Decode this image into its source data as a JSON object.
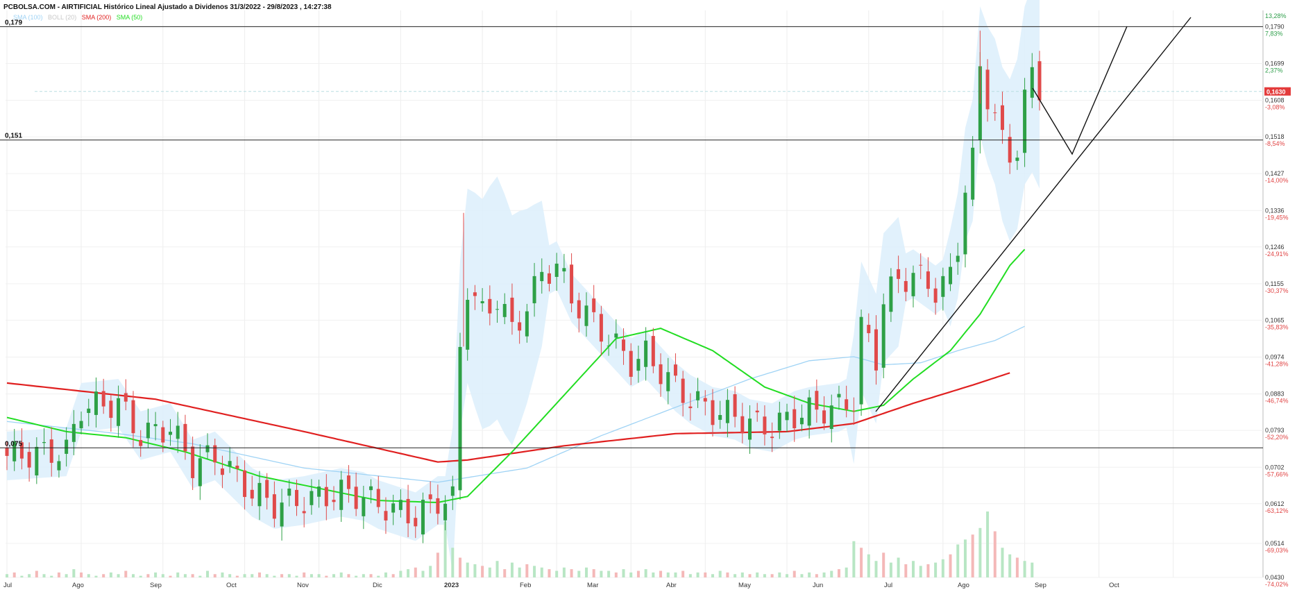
{
  "header": {
    "title": "PCBOLSA.COM - AIRTIFICIAL Histórico Lineal Ajustado a Dividenos 31/3/2022 - 29/8/2023 , 14:27:38"
  },
  "legend": [
    {
      "label": "SMA (100)",
      "color": "#9fd3f5"
    },
    {
      "label": "BOLL (20)",
      "color": "#c8c8c8"
    },
    {
      "label": "SMA (200)",
      "color": "#e02020"
    },
    {
      "label": "SMA (50)",
      "color": "#22dd22"
    }
  ],
  "colors": {
    "up": "#2ea046",
    "down": "#e04a4a",
    "band": "#dceefb",
    "sma100": "#9fd3f5",
    "sma200": "#e02020",
    "sma50": "#22dd22"
  },
  "chart_data": {
    "type": "candlestick",
    "ylim": [
      0.043,
      0.183
    ],
    "last_price": "0,1630",
    "x_labels": [
      "Jul",
      "Ago",
      "Sep",
      "Oct",
      "Nov",
      "Dic",
      "2023",
      "Feb",
      "Mar",
      "Abr",
      "May",
      "Jun",
      "Jul",
      "Ago",
      "Sep",
      "Oct"
    ],
    "y_ticks": [
      {
        "price": "0,1790",
        "pct": "7,83%"
      },
      {
        "price": "0,1699",
        "pct": "2,37%"
      },
      {
        "price": "0,1608",
        "pct": "-3,08%"
      },
      {
        "price": "0,1518",
        "pct": "-8,54%"
      },
      {
        "price": "0,1427",
        "pct": "-14,00%"
      },
      {
        "price": "0,1336",
        "pct": "-19,45%"
      },
      {
        "price": "0,1246",
        "pct": "-24,91%"
      },
      {
        "price": "0,1155",
        "pct": "-30,37%"
      },
      {
        "price": "0,1065",
        "pct": "-35,83%"
      },
      {
        "price": "0,0974",
        "pct": "-41,28%"
      },
      {
        "price": "0,0883",
        "pct": "-46,74%"
      },
      {
        "price": "0,0793",
        "pct": "-52,20%"
      },
      {
        "price": "0,0702",
        "pct": "-57,66%"
      },
      {
        "price": "0,0612",
        "pct": "-63,12%"
      },
      {
        "price": "0,0514",
        "pct": "-69,03%"
      },
      {
        "price": "0,0430",
        "pct": "-74,02%"
      }
    ],
    "top_pct": "13,28%",
    "horizontal_levels": [
      {
        "label": "0,179",
        "value": 0.179
      },
      {
        "label": "0,151",
        "value": 0.151
      },
      {
        "label": "0,075",
        "value": 0.075
      }
    ],
    "price_path": [
      [
        0,
        0.073
      ],
      [
        8,
        0.074
      ],
      [
        10,
        0.085
      ],
      [
        15,
        0.086
      ],
      [
        18,
        0.078
      ],
      [
        22,
        0.08
      ],
      [
        25,
        0.071
      ],
      [
        28,
        0.073
      ],
      [
        33,
        0.064
      ],
      [
        36,
        0.061
      ],
      [
        40,
        0.062
      ],
      [
        45,
        0.064
      ],
      [
        48,
        0.063
      ],
      [
        50,
        0.061
      ],
      [
        55,
        0.058
      ],
      [
        58,
        0.062
      ],
      [
        60,
        0.062
      ],
      [
        61,
        0.1
      ],
      [
        62,
        0.115
      ],
      [
        64,
        0.108
      ],
      [
        66,
        0.112
      ],
      [
        68,
        0.104
      ],
      [
        70,
        0.11
      ],
      [
        72,
        0.118
      ],
      [
        74,
        0.12
      ],
      [
        76,
        0.112
      ],
      [
        78,
        0.108
      ],
      [
        80,
        0.104
      ],
      [
        82,
        0.1
      ],
      [
        84,
        0.096
      ],
      [
        86,
        0.098
      ],
      [
        88,
        0.094
      ],
      [
        90,
        0.09
      ],
      [
        92,
        0.087
      ],
      [
        95,
        0.084
      ],
      [
        98,
        0.083
      ],
      [
        100,
        0.081
      ],
      [
        103,
        0.08
      ],
      [
        106,
        0.083
      ],
      [
        108,
        0.084
      ],
      [
        112,
        0.085
      ],
      [
        114,
        0.087
      ],
      [
        115,
        0.105
      ],
      [
        117,
        0.097
      ],
      [
        118,
        0.112
      ],
      [
        120,
        0.116
      ],
      [
        122,
        0.118
      ],
      [
        125,
        0.114
      ],
      [
        127,
        0.117
      ],
      [
        128,
        0.125
      ],
      [
        129,
        0.14
      ],
      [
        130,
        0.146
      ],
      [
        131,
        0.168
      ],
      [
        132,
        0.162
      ],
      [
        133,
        0.158
      ],
      [
        134,
        0.15
      ],
      [
        135,
        0.146
      ],
      [
        136,
        0.15
      ],
      [
        137,
        0.162
      ],
      [
        138,
        0.166
      ],
      [
        139,
        0.163
      ]
    ],
    "sma200": [
      [
        0,
        0.091
      ],
      [
        20,
        0.087
      ],
      [
        40,
        0.079
      ],
      [
        58,
        0.0715
      ],
      [
        62,
        0.072
      ],
      [
        75,
        0.0755
      ],
      [
        90,
        0.0785
      ],
      [
        105,
        0.079
      ],
      [
        114,
        0.081
      ],
      [
        122,
        0.086
      ],
      [
        130,
        0.0905
      ],
      [
        135,
        0.0935
      ]
    ],
    "sma50": [
      [
        0,
        0.0825
      ],
      [
        8,
        0.079
      ],
      [
        16,
        0.0775
      ],
      [
        24,
        0.074
      ],
      [
        34,
        0.068
      ],
      [
        42,
        0.065
      ],
      [
        50,
        0.062
      ],
      [
        58,
        0.0615
      ],
      [
        62,
        0.063
      ],
      [
        68,
        0.074
      ],
      [
        75,
        0.088
      ],
      [
        82,
        0.102
      ],
      [
        88,
        0.1045
      ],
      [
        95,
        0.099
      ],
      [
        102,
        0.09
      ],
      [
        108,
        0.086
      ],
      [
        114,
        0.084
      ],
      [
        118,
        0.0855
      ],
      [
        122,
        0.092
      ],
      [
        127,
        0.099
      ],
      [
        131,
        0.108
      ],
      [
        135,
        0.12
      ],
      [
        137,
        0.124
      ]
    ],
    "sma100": [
      [
        0,
        0.0815
      ],
      [
        15,
        0.0785
      ],
      [
        25,
        0.076
      ],
      [
        40,
        0.07
      ],
      [
        58,
        0.0665
      ],
      [
        70,
        0.07
      ],
      [
        80,
        0.078
      ],
      [
        90,
        0.085
      ],
      [
        100,
        0.092
      ],
      [
        108,
        0.0965
      ],
      [
        114,
        0.0975
      ],
      [
        118,
        0.0955
      ],
      [
        123,
        0.096
      ],
      [
        128,
        0.099
      ],
      [
        133,
        0.1015
      ],
      [
        137,
        0.105
      ]
    ],
    "volume": [
      2,
      3,
      1,
      2,
      4,
      2,
      1,
      3,
      2,
      5,
      3,
      2,
      1,
      2,
      3,
      2,
      4,
      2,
      1,
      2,
      3,
      2,
      1,
      3,
      2,
      2,
      1,
      4,
      2,
      3,
      2,
      1,
      2,
      2,
      3,
      2,
      1,
      2,
      2,
      1,
      3,
      2,
      2,
      1,
      2,
      3,
      2,
      1,
      2,
      2,
      1,
      3,
      2,
      4,
      5,
      6,
      4,
      7,
      15,
      34,
      18,
      12,
      9,
      8,
      7,
      6,
      10,
      5,
      9,
      6,
      8,
      7,
      6,
      5,
      4,
      6,
      5,
      4,
      6,
      5,
      4,
      4,
      3,
      5,
      3,
      4,
      5,
      3,
      4,
      3,
      3,
      4,
      2,
      3,
      3,
      2,
      4,
      3,
      2,
      3,
      2,
      3,
      2,
      2,
      3,
      2,
      4,
      2,
      3,
      2,
      3,
      4,
      5,
      6,
      22,
      18,
      14,
      10,
      15,
      9,
      12,
      8,
      10,
      7,
      8,
      9,
      11,
      14,
      20,
      23,
      26,
      30,
      40,
      28,
      18,
      14,
      12,
      10,
      9
    ]
  }
}
